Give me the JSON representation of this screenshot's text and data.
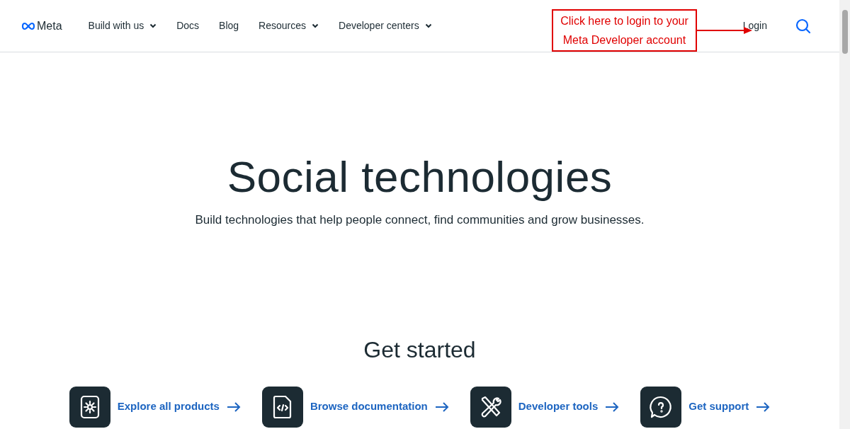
{
  "header": {
    "logo": "Meta",
    "nav": [
      {
        "label": "Build with us",
        "kind": "dropdown"
      },
      {
        "label": "Docs",
        "kind": "link"
      },
      {
        "label": "Blog",
        "kind": "link"
      },
      {
        "label": "Resources",
        "kind": "dropdown"
      },
      {
        "label": "Developer centers",
        "kind": "dropdown"
      }
    ],
    "login": "Login"
  },
  "callout": {
    "text": "Click here to login to your Meta Developer account"
  },
  "hero": {
    "title": "Social technologies",
    "subtitle": "Build technologies that help people connect, find communities and grow businesses."
  },
  "get_started": {
    "title": "Get started",
    "cards": [
      {
        "label": "Explore all products",
        "kind": "gear"
      },
      {
        "label": "Browse documentation",
        "kind": "code"
      },
      {
        "label": "Developer tools",
        "kind": "tools"
      },
      {
        "label": "Get support",
        "kind": "help"
      }
    ]
  }
}
